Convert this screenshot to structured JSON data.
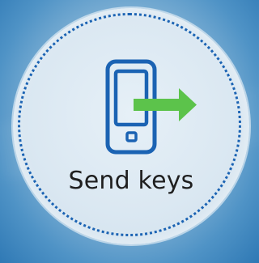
{
  "button": {
    "label": "Send keys",
    "icon": "phone-send-icon"
  },
  "colors": {
    "ring": "#1b63b3",
    "phone_stroke": "#1b63b3",
    "arrow": "#5cc34b",
    "label_text": "#1f1f1f",
    "background": "#2f79b5"
  }
}
